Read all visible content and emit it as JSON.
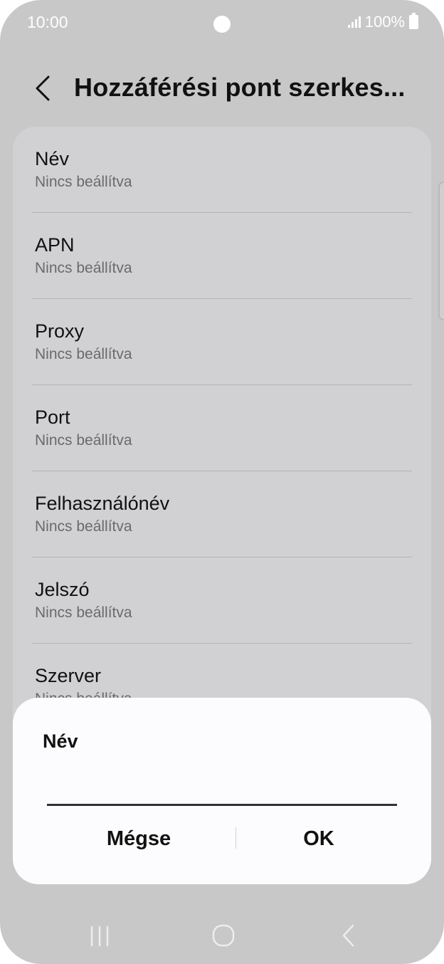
{
  "status_bar": {
    "time": "10:00",
    "battery": "100%"
  },
  "header": {
    "title": "Hozzáférési pont szerkes..."
  },
  "settings": {
    "items": [
      {
        "title": "Név",
        "value": "Nincs beállítva"
      },
      {
        "title": "APN",
        "value": "Nincs beállítva"
      },
      {
        "title": "Proxy",
        "value": "Nincs beállítva"
      },
      {
        "title": "Port",
        "value": "Nincs beállítva"
      },
      {
        "title": "Felhasználónév",
        "value": "Nincs beállítva"
      },
      {
        "title": "Jelszó",
        "value": "Nincs beállítva"
      },
      {
        "title": "Szerver",
        "value": "Nincs beállítva"
      }
    ]
  },
  "dialog": {
    "title": "Név",
    "input_value": "",
    "cancel_label": "Mégse",
    "ok_label": "OK"
  },
  "icons": {
    "back": "chevron-left-icon",
    "signal": "signal-icon",
    "battery": "battery-icon",
    "recents": "recents-icon",
    "home": "home-icon",
    "nav_back": "nav-back-icon"
  },
  "colors": {
    "background": "#c8c8c9",
    "card": "#d1d1d3",
    "dialog": "#fcfcfe"
  }
}
